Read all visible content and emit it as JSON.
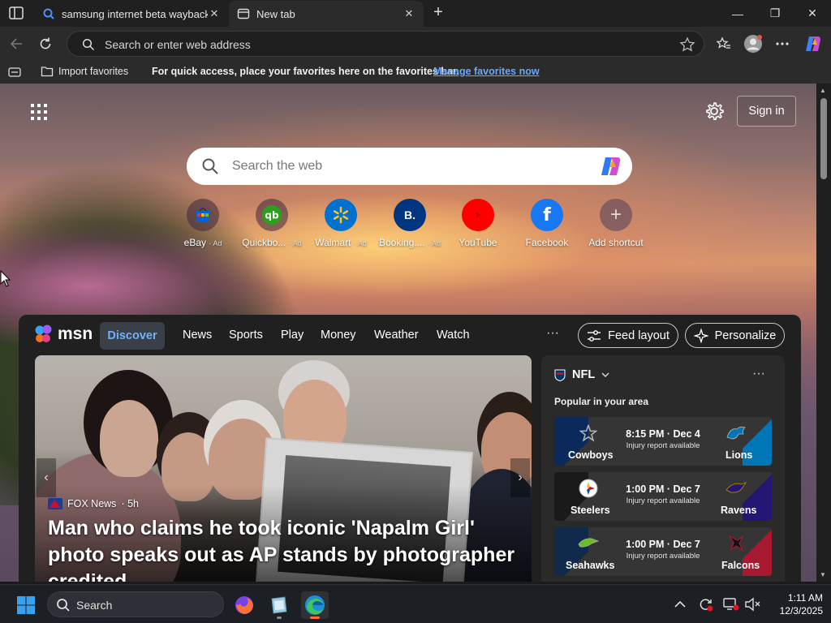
{
  "tabs": [
    {
      "title": "samsung internet beta wayback m",
      "close": "✕"
    },
    {
      "title": "New tab",
      "close": "✕"
    }
  ],
  "new_tab_symbol": "+",
  "window_controls": {
    "minimize": "—",
    "restore": "❐",
    "close": "✕"
  },
  "address_bar": {
    "placeholder": "Search or enter web address"
  },
  "favorites_bar": {
    "import_label": "Import favorites",
    "message": "For quick access, place your favorites here on the favorites bar.",
    "manage_link": "Manage favorites now"
  },
  "newtab": {
    "sign_in": "Sign in",
    "search_placeholder": "Search the web",
    "shortcuts": [
      {
        "label": "eBay",
        "ad": "· Ad",
        "icon": "ebay-icon"
      },
      {
        "label": "Quickbo...",
        "ad": "· Ad",
        "icon": "quickbooks-icon"
      },
      {
        "label": "Walmart",
        "ad": "· Ad",
        "icon": "walmart-icon"
      },
      {
        "label": "Booking....",
        "ad": "· Ad",
        "icon": "booking-icon"
      },
      {
        "label": "YouTube",
        "ad": "",
        "icon": "youtube-icon"
      },
      {
        "label": "Facebook",
        "ad": "",
        "icon": "facebook-icon"
      },
      {
        "label": "Add shortcut",
        "ad": "",
        "icon": "plus-icon"
      }
    ]
  },
  "msn": {
    "logo": "msn",
    "nav": [
      "Discover",
      "News",
      "Sports",
      "Play",
      "Money",
      "Weather",
      "Watch"
    ],
    "more": "···",
    "feed_layout": "Feed layout",
    "personalize": "Personalize"
  },
  "hero": {
    "source": "FOX News",
    "age": "· 5h",
    "headline": "Man who claims he took iconic 'Napalm Girl' photo speaks out as AP stands by photographer credited..."
  },
  "nfl": {
    "title": "NFL",
    "more": "···",
    "subtitle": "Popular in your area",
    "games": [
      {
        "home": "Cowboys",
        "away": "Lions",
        "time": "8:15 PM · Dec 4",
        "note": "Injury report available",
        "home_color": "#0b2a5b",
        "away_color": "#0076b6"
      },
      {
        "home": "Steelers",
        "away": "Ravens",
        "time": "1:00 PM · Dec 7",
        "note": "Injury report available",
        "home_color": "#1a1a1a",
        "away_color": "#241773"
      },
      {
        "home": "Seahawks",
        "away": "Falcons",
        "time": "1:00 PM · Dec 7",
        "note": "Injury report available",
        "home_color": "#0f2a4a",
        "away_color": "#a71930"
      }
    ]
  },
  "taskbar": {
    "search_label": "Search",
    "time": "1:11 AM",
    "date": "12/3/2025"
  }
}
